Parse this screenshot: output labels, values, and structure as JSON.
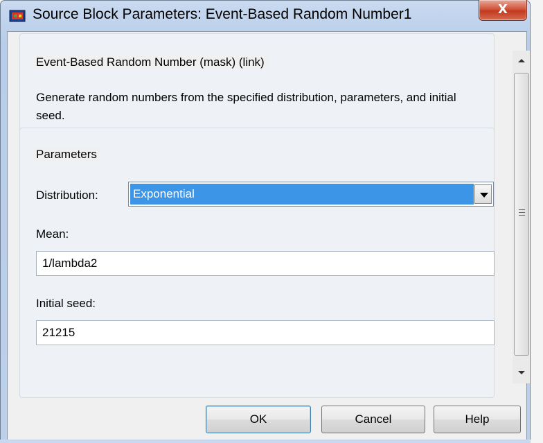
{
  "window": {
    "title": "Source Block Parameters: Event-Based Random Number1",
    "close_label": "X"
  },
  "mask": {
    "legend": "Event-Based Random Number (mask) (link)",
    "description": "Generate random numbers from the specified distribution, parameters, and initial seed."
  },
  "parameters": {
    "legend": "Parameters",
    "distribution_label": "Distribution:",
    "distribution_value": "Exponential",
    "mean_label": "Mean:",
    "mean_value": "1/lambda2",
    "seed_label": "Initial seed:",
    "seed_value": "21215"
  },
  "buttons": {
    "ok": "OK",
    "cancel": "Cancel",
    "help": "Help"
  },
  "colors": {
    "selection": "#3d95e8",
    "close": "#c23a20",
    "title_bar": "#c9daf0"
  },
  "icons": {
    "app": "simulink-block-icon",
    "close": "close-icon",
    "dropdown": "chevron-down-icon",
    "scroll_up": "arrow-up-icon",
    "scroll_down": "arrow-down-icon"
  }
}
